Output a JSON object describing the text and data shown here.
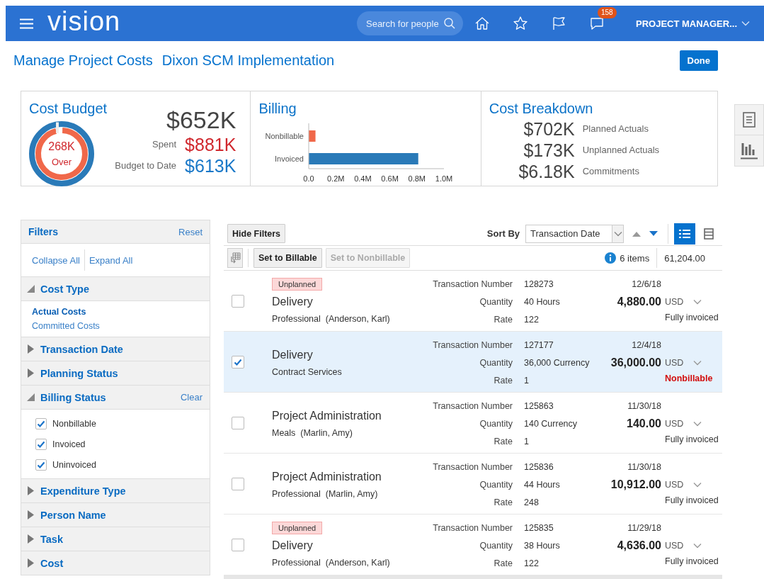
{
  "header": {
    "logo": "vision",
    "search": {
      "placeholder": "Search for people"
    },
    "notifications": {
      "count": "158"
    },
    "user": "PROJECT MANAGER..."
  },
  "title_bar": {
    "title": "Manage Project Costs",
    "project": "Dixon SCM Implementation",
    "done_button": "Done"
  },
  "cost_budget": {
    "title": "Cost Budget",
    "gauge": {
      "amount": "268K",
      "note": "Over"
    },
    "total": "$652K",
    "metrics": [
      {
        "label": "Spent",
        "value": "$881K",
        "kind": "alert"
      },
      {
        "label": "Budget to Date",
        "value": "$613K",
        "kind": "info"
      }
    ]
  },
  "billing": {
    "title": "Billing",
    "chart_data": {
      "type": "bar",
      "orientation": "horizontal",
      "stacked": true,
      "series": [
        {
          "name": "Nonbillable",
          "color": "#f0684a",
          "values": [
            0.05,
            null
          ]
        },
        {
          "name": "Invoiced",
          "color": "#2a7ab8",
          "values": [
            null,
            0.81
          ]
        }
      ],
      "xlim": [
        0,
        1
      ],
      "xticks": [
        {
          "value": 0,
          "label": "0.0"
        },
        {
          "value": 0.2,
          "label": "0.2M"
        },
        {
          "value": 0.4,
          "label": "0.4M"
        },
        {
          "value": 0.6,
          "label": "0.6M"
        },
        {
          "value": 0.8,
          "label": "0.8M"
        },
        {
          "value": 1,
          "label": "1.0M"
        }
      ]
    }
  },
  "cost_breakdown": {
    "title": "Cost Breakdown",
    "items": [
      {
        "amount": "$702K",
        "label": "Planned Actuals"
      },
      {
        "amount": "$173K",
        "label": "Unplanned Actuals"
      },
      {
        "amount": "$6.18K",
        "label": "Commitments"
      }
    ]
  },
  "side_tools": [
    {
      "kind": "document"
    },
    {
      "kind": "chart"
    }
  ],
  "filters": {
    "title": "Filters",
    "reset": "Reset",
    "collapse_all": "Collapse All",
    "expand_all": "Expand All",
    "sections": [
      {
        "title": "Cost Type",
        "expanded": true,
        "kind": "links",
        "items": [
          {
            "label": "Actual Costs",
            "selected": true
          },
          {
            "label": "Committed Costs",
            "selected": false
          }
        ]
      },
      {
        "title": "Transaction Date",
        "expanded": false
      },
      {
        "title": "Planning Status",
        "expanded": false
      },
      {
        "title": "Billing Status",
        "expanded": true,
        "action": "Clear",
        "kind": "checkboxes",
        "items": [
          {
            "label": "Nonbillable",
            "checked": true
          },
          {
            "label": "Invoiced",
            "checked": true
          },
          {
            "label": "Uninvoiced",
            "checked": true
          }
        ]
      },
      {
        "title": "Expenditure Type",
        "expanded": false
      },
      {
        "title": "Person Name",
        "expanded": false
      },
      {
        "title": "Task",
        "expanded": false
      },
      {
        "title": "Cost",
        "expanded": false
      }
    ]
  },
  "toolbar": {
    "hide_filters": "Hide Filters",
    "sort_label": "Sort By",
    "sort_field": "Transaction Date",
    "sort_descending": true,
    "views": [
      {
        "kind": "list",
        "selected": true
      },
      {
        "kind": "table",
        "selected": false
      }
    ],
    "actions": [
      {
        "label": "Set to Billable",
        "disabled": false
      },
      {
        "label": "Set to Nonbillable",
        "disabled": true
      }
    ],
    "item_count": "6 items",
    "total": "61,204.00"
  },
  "rows": [
    {
      "selected": false,
      "tag": "Unplanned",
      "title": "Delivery",
      "subtitle": "Professional  (Anderson, Karl)",
      "fields": [
        {
          "label": "Transaction Number",
          "value": "128273"
        },
        {
          "label": "Quantity",
          "value": "40 Hours"
        },
        {
          "label": "Rate",
          "value": "122"
        }
      ],
      "date": "12/6/18",
      "amount": "4,880.00",
      "currency": "USD",
      "status": {
        "label": "Fully invoiced",
        "kind": "invoiced"
      }
    },
    {
      "selected": true,
      "title": "Delivery",
      "subtitle": "Contract Services",
      "fields": [
        {
          "label": "Transaction Number",
          "value": "127177"
        },
        {
          "label": "Quantity",
          "value": "36,000 Currency"
        },
        {
          "label": "Rate",
          "value": "1"
        }
      ],
      "date": "12/4/18",
      "amount": "36,000.00",
      "currency": "USD",
      "status": {
        "label": "Nonbillable",
        "kind": "nonbillable"
      }
    },
    {
      "selected": false,
      "title": "Project Administration",
      "subtitle": "Meals  (Marlin, Amy)",
      "fields": [
        {
          "label": "Transaction Number",
          "value": "125863"
        },
        {
          "label": "Quantity",
          "value": "140 Currency"
        },
        {
          "label": "Rate",
          "value": "1"
        }
      ],
      "date": "11/30/18",
      "amount": "140.00",
      "currency": "USD",
      "status": {
        "label": "Fully invoiced",
        "kind": "invoiced"
      }
    },
    {
      "selected": false,
      "title": "Project Administration",
      "subtitle": "Professional  (Marlin, Amy)",
      "fields": [
        {
          "label": "Transaction Number",
          "value": "125836"
        },
        {
          "label": "Quantity",
          "value": "44 Hours"
        },
        {
          "label": "Rate",
          "value": "248"
        }
      ],
      "date": "11/30/18",
      "amount": "10,912.00",
      "currency": "USD",
      "status": {
        "label": "Fully invoiced",
        "kind": "invoiced"
      }
    },
    {
      "selected": false,
      "tag": "Unplanned",
      "title": "Delivery",
      "subtitle": "Professional  (Anderson, Karl)",
      "fields": [
        {
          "label": "Transaction Number",
          "value": "125835"
        },
        {
          "label": "Quantity",
          "value": "38 Hours"
        },
        {
          "label": "Rate",
          "value": "122"
        }
      ],
      "date": "11/29/18",
      "amount": "4,636.00",
      "currency": "USD",
      "status": {
        "label": "Fully invoiced",
        "kind": "invoiced"
      }
    }
  ]
}
